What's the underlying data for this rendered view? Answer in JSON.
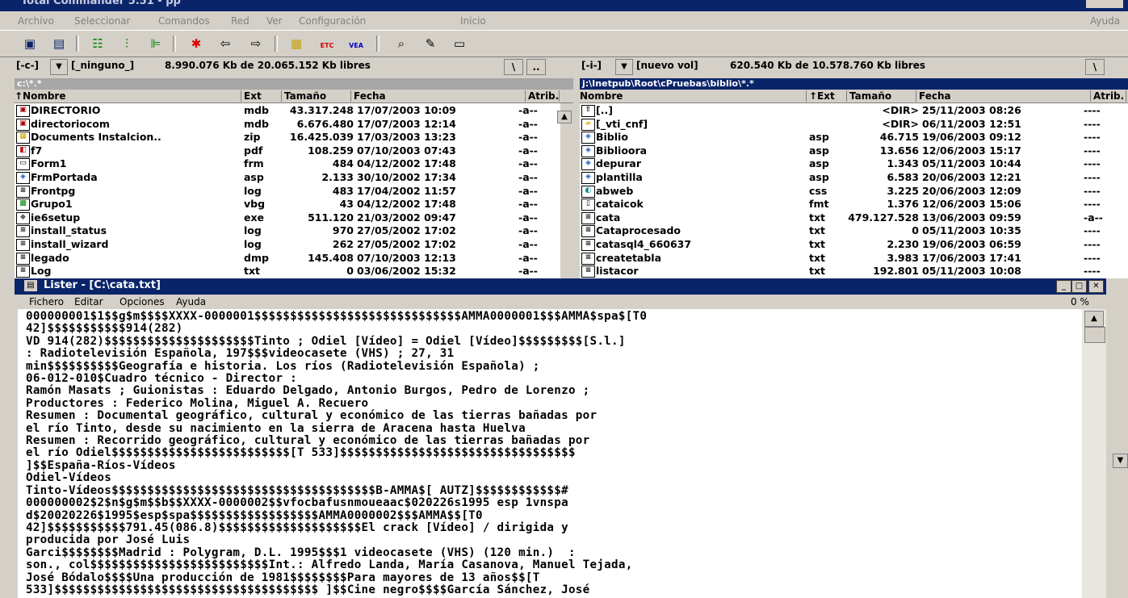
{
  "app": {
    "title": "Total Commander 5.51 - pp",
    "menu": [
      "Archivo",
      "Seleccionar",
      "Comandos",
      "Red",
      "Ver",
      "Configuración",
      "Inicio"
    ],
    "help_menu": "Ayuda"
  },
  "toolbar": {
    "icons": [
      "refresh-icon",
      "brief-view-icon",
      "full-view-icon",
      "tree-icon",
      "ftp-icon",
      "select-all-icon",
      "back-icon",
      "forward-icon",
      "pack-icon",
      "unpack-icon",
      "zip-icon",
      "search-icon",
      "rename-icon",
      "view-icon"
    ],
    "badges": {
      "etc": "ETC",
      "vea": "VEA"
    }
  },
  "left": {
    "drive": "[-c-]",
    "label": "[_ninguno_]",
    "free": "8.990.076 Kb de 20.065.152 Kb libres",
    "root_btn": "\\",
    "up_btn": "..",
    "path": "c:\\*.*",
    "headers": {
      "name": "↑Nombre",
      "ext": "Ext",
      "size": "Tamaño",
      "date": "Fecha",
      "attr": "Atrib."
    },
    "files": [
      {
        "icon": "database-icon",
        "name": "DIRECTORIO",
        "ext": "mdb",
        "size": "43.317.248",
        "date": "17/07/2003 10:09",
        "attr": "-a--"
      },
      {
        "icon": "database-icon",
        "name": "directoriocom",
        "ext": "mdb",
        "size": "6.676.480",
        "date": "17/07/2003 12:14",
        "attr": "-a--"
      },
      {
        "icon": "zip-icon",
        "name": "Documents Instalcion..",
        "ext": "zip",
        "size": "16.425.039",
        "date": "17/03/2003 13:23",
        "attr": "-a--"
      },
      {
        "icon": "pdf-icon",
        "name": "f7",
        "ext": "pdf",
        "size": "108.259",
        "date": "07/10/2003 07:43",
        "attr": "-a--"
      },
      {
        "icon": "form-icon",
        "name": "Form1",
        "ext": "frm",
        "size": "484",
        "date": "04/12/2002 17:48",
        "attr": "-a--"
      },
      {
        "icon": "asp-icon",
        "name": "FrmPortada",
        "ext": "asp",
        "size": "2.133",
        "date": "30/10/2002 17:34",
        "attr": "-a--"
      },
      {
        "icon": "text-file-icon",
        "name": "Frontpg",
        "ext": "log",
        "size": "483",
        "date": "17/04/2002 11:57",
        "attr": "-a--"
      },
      {
        "icon": "vbg-icon",
        "name": "Grupo1",
        "ext": "vbg",
        "size": "43",
        "date": "04/12/2002 17:48",
        "attr": "-a--"
      },
      {
        "icon": "exe-icon",
        "name": "ie6setup",
        "ext": "exe",
        "size": "511.120",
        "date": "21/03/2002 09:47",
        "attr": "-a--"
      },
      {
        "icon": "text-file-icon",
        "name": "install_status",
        "ext": "log",
        "size": "970",
        "date": "27/05/2002 17:02",
        "attr": "-a--"
      },
      {
        "icon": "text-file-icon",
        "name": "install_wizard",
        "ext": "log",
        "size": "262",
        "date": "27/05/2002 17:02",
        "attr": "-a--"
      },
      {
        "icon": "text-file-icon",
        "name": "legado",
        "ext": "dmp",
        "size": "145.408",
        "date": "07/10/2003 12:13",
        "attr": "-a--"
      },
      {
        "icon": "text-file-icon",
        "name": "Log",
        "ext": "txt",
        "size": "0",
        "date": "03/06/2002 15:32",
        "attr": "-a--"
      }
    ]
  },
  "right": {
    "drive": "[-i-]",
    "label": "[nuevo vol]",
    "free": "620.540 Kb de 10.578.760 Kb libres",
    "root_btn": "\\",
    "path": "j:\\Inetpub\\Root\\cPruebas\\biblio\\*.*",
    "headers": {
      "name": "Nombre",
      "ext": "↑Ext",
      "size": "Tamaño",
      "date": "Fecha",
      "attr": "Atrib."
    },
    "files": [
      {
        "icon": "up-dir-icon",
        "name": "[..]",
        "ext": "",
        "size": "<DIR>",
        "date": "25/11/2003 08:26",
        "attr": "----"
      },
      {
        "icon": "folder-icon",
        "name": "[_vti_cnf]",
        "ext": "",
        "size": "<DIR>",
        "date": "06/11/2003 12:51",
        "attr": "----"
      },
      {
        "icon": "asp-icon",
        "name": "Biblio",
        "ext": "asp",
        "size": "46.715",
        "date": "19/06/2003 09:12",
        "attr": "----"
      },
      {
        "icon": "asp-icon",
        "name": "Biblioora",
        "ext": "asp",
        "size": "13.656",
        "date": "12/06/2003 15:17",
        "attr": "----"
      },
      {
        "icon": "asp-icon",
        "name": "depurar",
        "ext": "asp",
        "size": "1.343",
        "date": "05/11/2003 10:44",
        "attr": "----"
      },
      {
        "icon": "asp-icon",
        "name": "plantilla",
        "ext": "asp",
        "size": "6.583",
        "date": "20/06/2003 12:21",
        "attr": "----"
      },
      {
        "icon": "css-icon",
        "name": "abweb",
        "ext": "css",
        "size": "3.225",
        "date": "20/06/2003 12:09",
        "attr": "----"
      },
      {
        "icon": "blank-file-icon",
        "name": "cataicok",
        "ext": "fmt",
        "size": "1.376",
        "date": "12/06/2003 15:06",
        "attr": "----"
      },
      {
        "icon": "text-file-icon",
        "name": "cata",
        "ext": "txt",
        "size": "479.127.528",
        "date": "13/06/2003 09:59",
        "attr": "-a--"
      },
      {
        "icon": "text-file-icon",
        "name": "Cataprocesado",
        "ext": "txt",
        "size": "0",
        "date": "05/11/2003 10:35",
        "attr": "----"
      },
      {
        "icon": "text-file-icon",
        "name": "catasql4_660637",
        "ext": "txt",
        "size": "2.230",
        "date": "19/06/2003 06:59",
        "attr": "----"
      },
      {
        "icon": "text-file-icon",
        "name": "createtabla",
        "ext": "txt",
        "size": "3.983",
        "date": "17/06/2003 17:41",
        "attr": "----"
      },
      {
        "icon": "text-file-icon",
        "name": "listacor",
        "ext": "txt",
        "size": "192.801",
        "date": "05/11/2003 10:08",
        "attr": "----"
      }
    ]
  },
  "lister": {
    "title": "Lister - [C:\\cata.txt]",
    "menu": [
      "Fichero",
      "Editar",
      "Opciones",
      "Ayuda"
    ],
    "percent": "0 %",
    "lines": [
      "000000001$1$$g$m$$$$XXXX-0000001$$$$$$$$$$$$$$$$$$$$$$$$$$$$$AMMA0000001$$$AMMA$spa$[T0",
      "42]$$$$$$$$$$$914(282)",
      "VD 914(282)$$$$$$$$$$$$$$$$$$$$$Tinto ; Odiel [Vídeo] = Odiel [Vídeo]$$$$$$$$$[S.l.]",
      ": Radiotelevisión Española, 197$$$videocasete (VHS) ; 27, 31",
      "min$$$$$$$$$$Geografía e historia. Los ríos (Radiotelevisión Española) ;",
      "06-012-010$Cuadro técnico - Director :",
      "Ramón Masats ; Guionistas : Eduardo Delgado, Antonio Burgos, Pedro de Lorenzo ;",
      "Productores : Federico Molina, Miguel A. Recuero",
      "Resumen : Documental geográfico, cultural y económico de las tierras bañadas por",
      "el río Tinto, desde su nacimiento en la sierra de Aracena hasta Huelva",
      "Resumen : Recorrido geográfico, cultural y económico de las tierras bañadas por",
      "el río Odiel$$$$$$$$$$$$$$$$$$$$$$$$$[T 533]$$$$$$$$$$$$$$$$$$$$$$$$$$$$$$$$$",
      "]$$España-Ríos-Vídeos",
      "Odiel-Vídeos",
      "Tinto-Vídeos$$$$$$$$$$$$$$$$$$$$$$$$$$$$$$$$$$$$$B-AMMA$[ AUTZ]$$$$$$$$$$$$#",
      "000000002$2$n$g$m$$b$$XXXX-0000002$$vfocbafusnmoueaac$020226s1995 esp 1vnspa",
      "d$20020226$1995$esp$spa$$$$$$$$$$$$$$$$$$AMMA0000002$$$AMMA$$[T0",
      "42]$$$$$$$$$$$791.45(086.8)$$$$$$$$$$$$$$$$$$$$El crack [Vídeo] / dirigida y",
      "producida por José Luis",
      "Garci$$$$$$$$Madrid : Polygram, D.L. 1995$$$1 videocasete (VHS) (120 min.)  :",
      "son., col$$$$$$$$$$$$$$$$$$$$$$$$$Int.: Alfredo Landa, María Casanova, Manuel Tejada,",
      "José Bódalo$$$$Una producción de 1981$$$$$$$$Para mayores de 13 años$$[T",
      "533]$$$$$$$$$$$$$$$$$$$$$$$$$$$$$$$$$$$$$ ]$$Cine negro$$$$García Sánchez, José"
    ]
  }
}
